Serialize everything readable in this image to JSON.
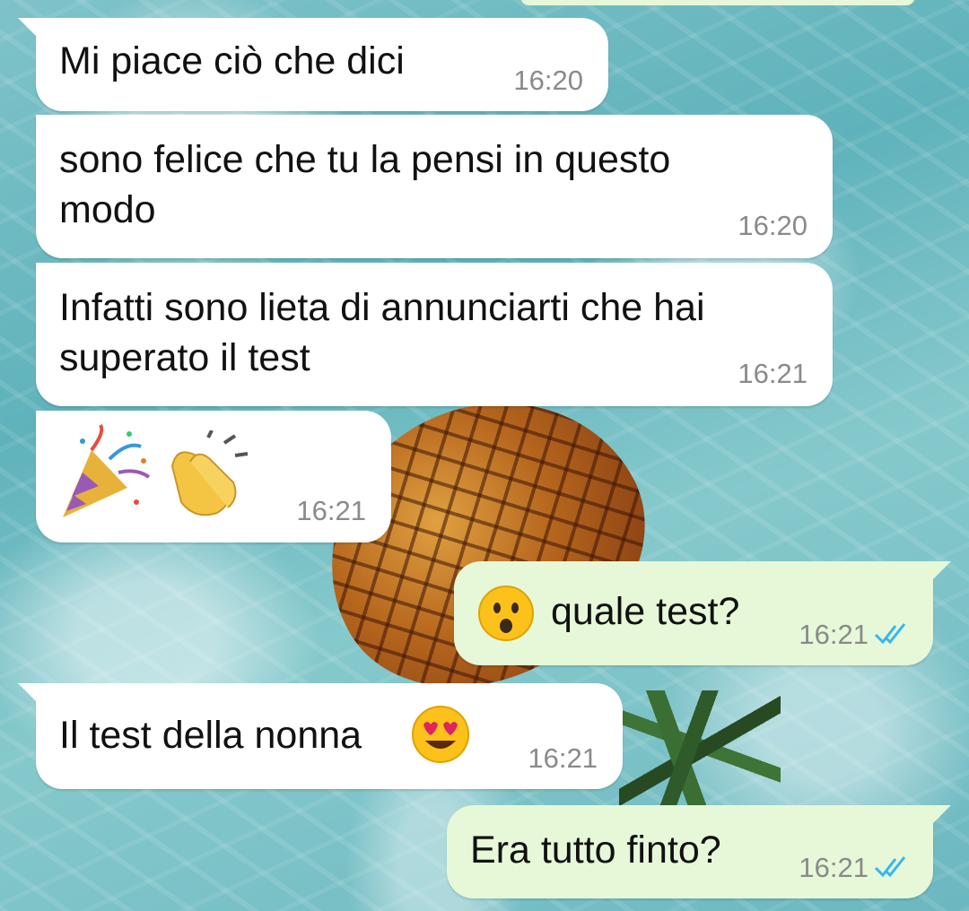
{
  "theme": {
    "incoming_bg": "#ffffff",
    "outgoing_bg": "#e6f8d8",
    "read_tick_color": "#34b7f1"
  },
  "messages": [
    {
      "direction": "in",
      "text": "Mi piace ciò che dici",
      "time": "16:20"
    },
    {
      "direction": "in",
      "text": "sono felice che tu la pensi in questo\nmodo",
      "time": "16:20"
    },
    {
      "direction": "in",
      "text": "Infatti sono lieta di annunciarti che hai\nsuperato il test",
      "time": "16:21"
    },
    {
      "direction": "in",
      "emoji": [
        "party-popper",
        "clapping-hands"
      ],
      "time": "16:21"
    },
    {
      "direction": "out",
      "emoji": "hushed-face",
      "text": "quale test?",
      "time": "16:21",
      "status": "read"
    },
    {
      "direction": "in",
      "text": "Il test della nonna",
      "emoji": "heart-eyes-face",
      "time": "16:21"
    },
    {
      "direction": "out",
      "text": "Era tutto finto?",
      "time": "16:21",
      "status": "read"
    }
  ]
}
